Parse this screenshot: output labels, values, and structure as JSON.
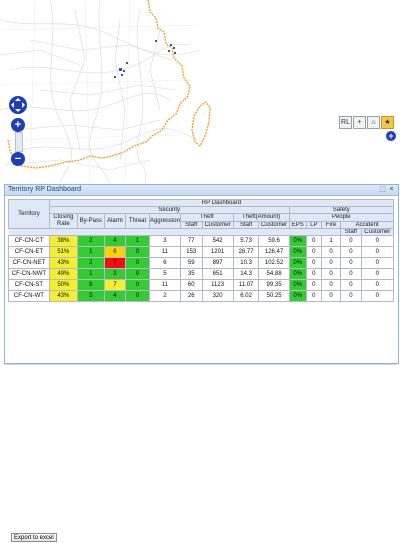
{
  "map": {
    "tools": [
      "RL",
      "+",
      "⌂",
      "★"
    ],
    "expand_icon": "plus"
  },
  "dashboard": {
    "panel_title": "Territory RP Dashboard",
    "header_tools": [
      "⬚",
      "×"
    ],
    "group_title": "RP Dashboard",
    "col_territory": "Territory",
    "security": "Security",
    "safety": "Safety",
    "theft": "Theft",
    "theft_amount": "Theft(Amount)",
    "people": "People",
    "accident": "Accident",
    "cols": {
      "closing_rate": "Closing Rate",
      "bypass": "By-Pass",
      "alarm": "Alarm",
      "threat": "Threat",
      "aggression": "Aggression",
      "theft_staff": "Staff",
      "theft_customer": "Customer",
      "amt_staff": "Staff",
      "amt_customer": "Customer",
      "eps": "EPS",
      "lp": "LP",
      "fire": "Fire",
      "acc_staff": "Staff",
      "acc_customer": "Customer"
    },
    "rows": [
      {
        "territory": "CF-CN-CT",
        "closing_rate": "38%",
        "bypass": "2",
        "alarm": "4",
        "threat": "1",
        "aggression": "3",
        "theft_staff": "77",
        "theft_customer": "542",
        "amt_staff": "5.73",
        "amt_customer": "59.6",
        "eps": "0%",
        "lp": "0",
        "fire": "1",
        "acc_staff": "0",
        "acc_customer": "0"
      },
      {
        "territory": "CF-CN-ET",
        "closing_rate": "51%",
        "bypass": "1",
        "alarm": "6",
        "threat": "0",
        "aggression": "11",
        "theft_staff": "153",
        "theft_customer": "1201",
        "amt_staff": "28.77",
        "amt_customer": "126.47",
        "eps": "0%",
        "lp": "0",
        "fire": "0",
        "acc_staff": "0",
        "acc_customer": "0"
      },
      {
        "territory": "CF-CN-NET",
        "closing_rate": "43%",
        "bypass": "2",
        "alarm": "7",
        "threat": "0",
        "aggression": "6",
        "theft_staff": "59",
        "theft_customer": "897",
        "amt_staff": "10.3",
        "amt_customer": "102.52",
        "eps": "0%",
        "lp": "0",
        "fire": "0",
        "acc_staff": "0",
        "acc_customer": "0"
      },
      {
        "territory": "CF-CN-NWT",
        "closing_rate": "49%",
        "bypass": "1",
        "alarm": "3",
        "threat": "0",
        "aggression": "5",
        "theft_staff": "35",
        "theft_customer": "651",
        "amt_staff": "14.3",
        "amt_customer": "54.88",
        "eps": "0%",
        "lp": "0",
        "fire": "0",
        "acc_staff": "0",
        "acc_customer": "0"
      },
      {
        "territory": "CF-CN-ST",
        "closing_rate": "50%",
        "bypass": "8",
        "alarm": "7",
        "threat": "0",
        "aggression": "11",
        "theft_staff": "60",
        "theft_customer": "1123",
        "amt_staff": "11.07",
        "amt_customer": "99.35",
        "eps": "0%",
        "lp": "0",
        "fire": "0",
        "acc_staff": "0",
        "acc_customer": "0"
      },
      {
        "territory": "CF-CN-WT",
        "closing_rate": "43%",
        "bypass": "3",
        "alarm": "4",
        "threat": "0",
        "aggression": "2",
        "theft_staff": "26",
        "theft_customer": "320",
        "amt_staff": "6.02",
        "amt_customer": "50.25",
        "eps": "0%",
        "lp": "0",
        "fire": "0",
        "acc_staff": "0",
        "acc_customer": "0"
      }
    ],
    "cell_colors": [
      {
        "closing_rate": "yellow",
        "bypass": "green",
        "alarm": "green",
        "threat": "green",
        "eps": "green"
      },
      {
        "closing_rate": "yellow",
        "bypass": "green",
        "alarm": "orange",
        "threat": "green",
        "eps": "green"
      },
      {
        "closing_rate": "yellow",
        "bypass": "green",
        "alarm": "red",
        "threat": "green",
        "eps": "green"
      },
      {
        "closing_rate": "yellow",
        "bypass": "green",
        "alarm": "green",
        "threat": "green",
        "eps": "green"
      },
      {
        "closing_rate": "yellow",
        "bypass": "green",
        "alarm": "yellow",
        "threat": "green",
        "eps": "green"
      },
      {
        "closing_rate": "yellow",
        "bypass": "green",
        "alarm": "green",
        "threat": "green",
        "eps": "green"
      }
    ],
    "export_label": "Export to excel"
  },
  "colors": {
    "coast": "#f29a22",
    "roads": "#c8cdd6",
    "markers": "#2f56c9",
    "nav": "#1c3fb8"
  }
}
